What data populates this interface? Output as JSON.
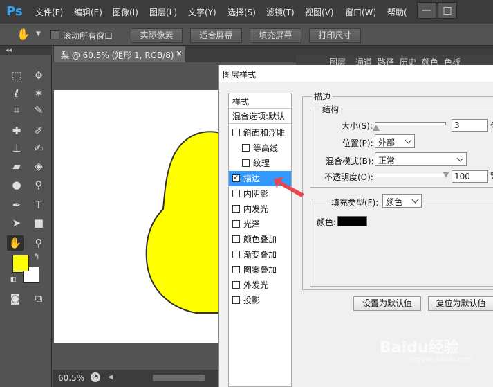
{
  "app": {
    "logo": "Ps"
  },
  "menu": [
    "文件(F)",
    "编辑(E)",
    "图像(I)",
    "图层(L)",
    "文字(Y)",
    "选择(S)",
    "滤镜(T)",
    "视图(V)",
    "窗口(W)",
    "帮助("
  ],
  "window_controls": {
    "minimize": "—",
    "restore": "□"
  },
  "options_bar": {
    "scroll_all_label": "滚动所有窗口",
    "buttons": [
      "实际像素",
      "适合屏幕",
      "填充屏幕",
      "打印尺寸"
    ]
  },
  "document": {
    "tab_title": "梨 @ 60.5% (矩形 1, RGB/8) *",
    "close": "×",
    "zoom": "60.5%"
  },
  "panels": {
    "tabs": [
      "图层",
      "通道",
      "路径",
      "历史",
      "颜色",
      "色板"
    ]
  },
  "dialog": {
    "title": "图层样式",
    "styles_header": "样式",
    "blend_default": "混合选项:默认",
    "style_items": [
      {
        "label": "斜面和浮雕",
        "checked": false
      },
      {
        "label": "等高线",
        "checked": false
      },
      {
        "label": "纹理",
        "checked": false
      },
      {
        "label": "描边",
        "checked": true
      },
      {
        "label": "内阴影",
        "checked": false
      },
      {
        "label": "内发光",
        "checked": false
      },
      {
        "label": "光泽",
        "checked": false
      },
      {
        "label": "颜色叠加",
        "checked": false
      },
      {
        "label": "渐变叠加",
        "checked": false
      },
      {
        "label": "图案叠加",
        "checked": false
      },
      {
        "label": "外发光",
        "checked": false
      },
      {
        "label": "投影",
        "checked": false
      }
    ],
    "checkmark": "✓",
    "stroke": {
      "group_title": "描边",
      "structure_title": "结构",
      "size_label": "大小(S):",
      "size_value": "3",
      "size_unit": "像",
      "size_fraction": 0.02,
      "position_label": "位置(P):",
      "position_value": "外部",
      "blend_label": "混合模式(B):",
      "blend_value": "正常",
      "opacity_label": "不透明度(O):",
      "opacity_value": "100",
      "opacity_unit": "%",
      "opacity_fraction": 1.0,
      "fill_type_label": "填充类型(F):",
      "fill_type_value": "颜色",
      "color_label": "颜色:",
      "color_value": "#000000"
    },
    "buttons": {
      "make_default": "设置为默认值",
      "reset_default": "复位为默认值"
    }
  },
  "colors": {
    "foreground": "#ffff00",
    "background": "#ffffff",
    "shape_fill": "#ffff00",
    "shape_stroke": "#333333",
    "selection": "#3399ff",
    "arrow": "#e8474e"
  },
  "watermark": {
    "text": "Baidu经验",
    "url": "jingyan.baidu.com"
  }
}
